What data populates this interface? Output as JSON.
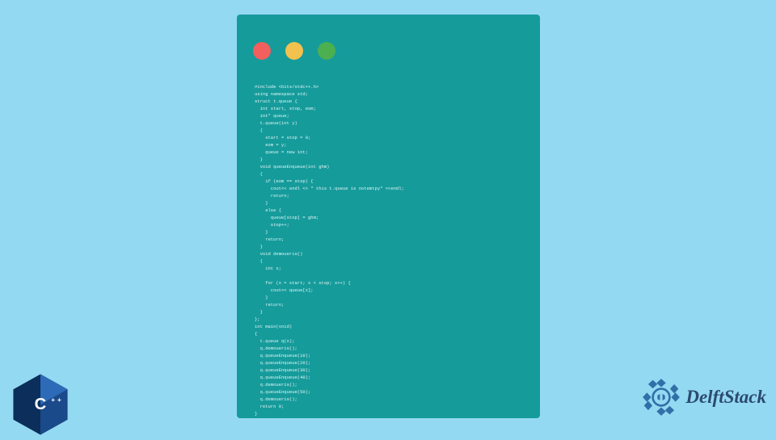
{
  "brand": "DelftStack",
  "cpp_label": "C++",
  "code": "#include <bits/stdc++.h>\nusing namespace std;\nstruct t.queue {\n  int start, stop, eom;\n  int* queue;\n  t.queue(int y)\n  {\n    start = stop = 0;\n    eom = y;\n    queue = new int;\n  }\n  void queueEnqueue(int ghm)\n  {\n    if (eom == stop) {\n      cout<< endl << \" this t.queue is notemtpy\" <<endl;\n      return;\n    }\n    else {\n      queue[stop] = ghm;\n      stop++;\n    }\n    return;\n  }\n  void demoueris()\n  {\n    int x;\n\n    for (x = start; x < stop; x++) {\n      cout<< queue[x];\n    }\n    return;\n  }\n};\nint main(void)\n{\n  t.queue q(x);\n  q.demoueris();\n  q.queueEnqueue(10);\n  q.queueEnqueue(20);\n  q.queueEnqueue(30);\n  q.queueEnqueue(40);\n  q.demoueris();\n  q.queueEnqueue(50);\n  q.demoueris();\n  return 0;\n}"
}
